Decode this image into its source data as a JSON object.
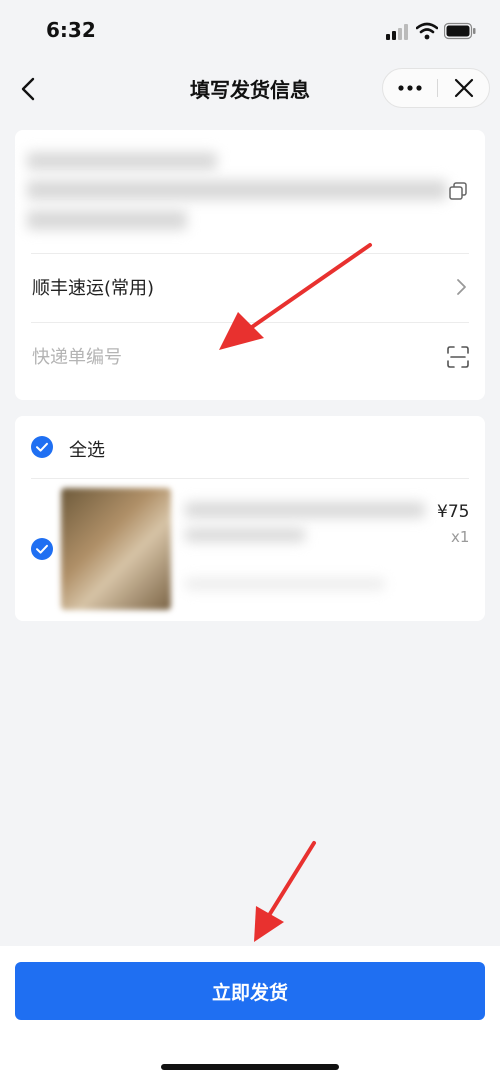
{
  "status_bar": {
    "time": "6:32"
  },
  "nav": {
    "title": "填写发货信息"
  },
  "shipping": {
    "courier_label": "顺丰速运(常用)",
    "tracking_placeholder": "快递单编号"
  },
  "goods": {
    "select_all_label": "全选",
    "items": [
      {
        "price": "¥75",
        "quantity": "x1"
      }
    ]
  },
  "footer": {
    "ship_button_label": "立即发货"
  },
  "colors": {
    "accent": "#1f6ff2",
    "annotation_arrow": "#e8312f",
    "background": "#f3f4f6"
  },
  "icons": {
    "back": "chevron-left-icon",
    "more": "more-dots-icon",
    "close": "close-icon",
    "copy": "copy-icon",
    "courier_chevron": "chevron-right-icon",
    "scan": "scan-icon",
    "check": "checkmark-circle-icon"
  }
}
